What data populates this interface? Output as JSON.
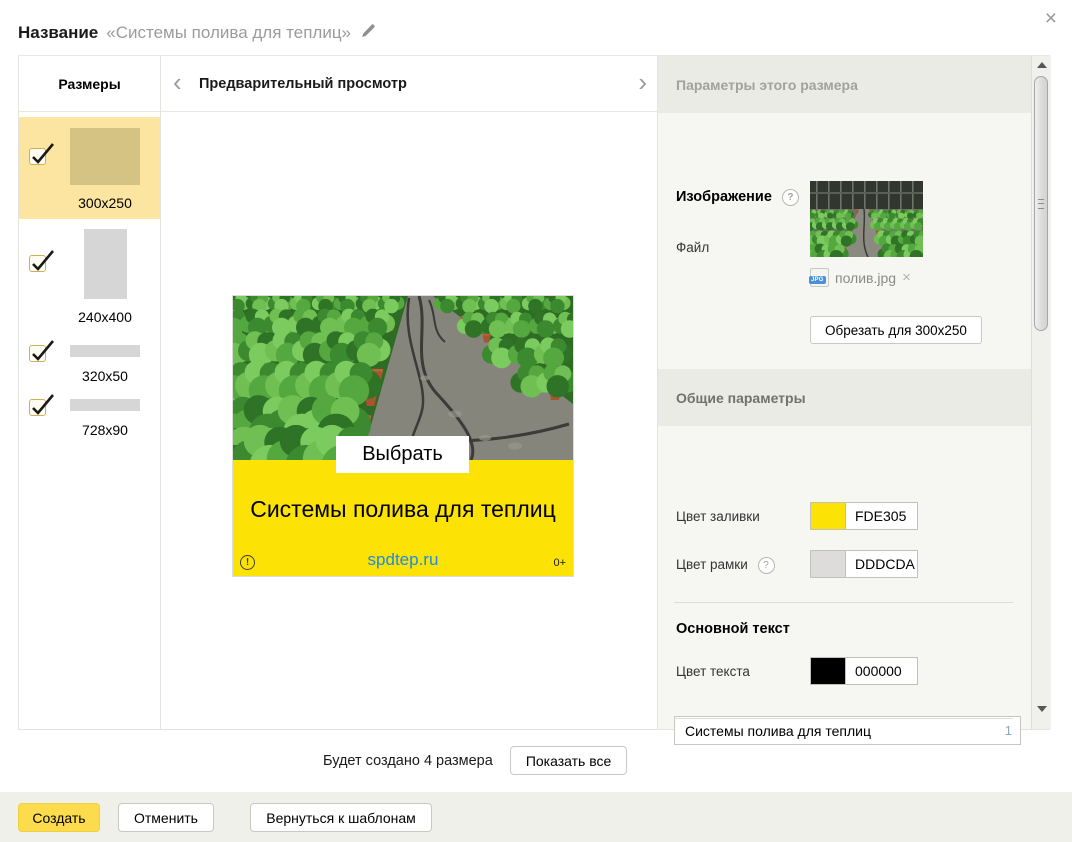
{
  "modal": {
    "title_label": "Название",
    "title_value": "«Системы полива для теплиц»"
  },
  "icons": {
    "close": "×",
    "prev": "‹",
    "next": "›",
    "help": "?",
    "remove": "×",
    "warning": "!"
  },
  "sidebar": {
    "header": "Размеры",
    "items": [
      {
        "label": "300x250",
        "checked": true,
        "selected": true
      },
      {
        "label": "240x400",
        "checked": true,
        "selected": false
      },
      {
        "label": "320x50",
        "checked": true,
        "selected": false
      },
      {
        "label": "728x90",
        "checked": true,
        "selected": false
      }
    ]
  },
  "preview": {
    "header": "Предварительный просмотр",
    "banner": {
      "button_label": "Выбрать",
      "headline": "Системы полива для теплиц",
      "domain": "spdtep.ru",
      "age_rating": "0+",
      "fill_color": "#FDE305"
    }
  },
  "params": {
    "section_this_size": "Параметры этого размера",
    "image_section": {
      "title": "Изображение",
      "file_label": "Файл",
      "file_type": "JPG",
      "file_name": "полив.jpg",
      "crop_button": "Обрезать для 300x250"
    },
    "common_section": {
      "title": "Общие параметры",
      "fill_label": "Цвет заливки",
      "fill_value": "FDE305",
      "fill_hex": "#FDE305",
      "frame_label": "Цвет рамки",
      "frame_value": "DDDCDA",
      "frame_hex": "#DDDCDA"
    },
    "text_section": {
      "title": "Основной текст",
      "color_label": "Цвет текста",
      "color_value": "000000",
      "color_hex": "#000000",
      "text_value": "Системы полива для теплиц",
      "counter": "1"
    }
  },
  "footer": {
    "summary": "Будет создано 4 размера",
    "show_all_button": "Показать все"
  },
  "actions": {
    "create": "Создать",
    "cancel": "Отменить",
    "back": "Вернуться к шаблонам"
  }
}
